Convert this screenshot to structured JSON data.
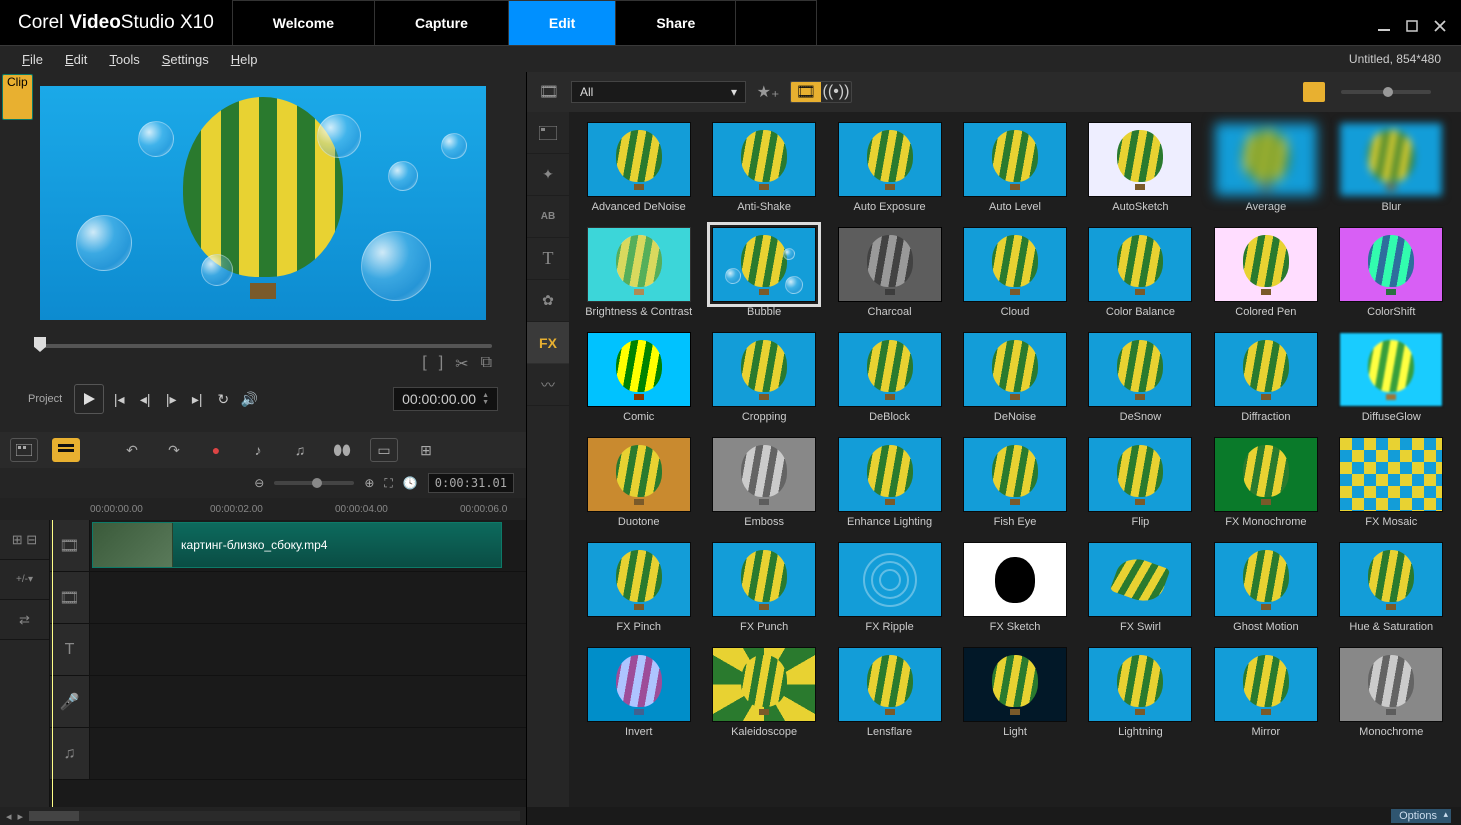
{
  "app": {
    "brand": "Corel",
    "product": "VideoStudio",
    "version": "X10"
  },
  "nav_tabs": {
    "welcome": "Welcome",
    "capture": "Capture",
    "edit": "Edit",
    "share": "Share",
    "active": "edit"
  },
  "project_info": "Untitled, 854*480",
  "menus": {
    "file": "File",
    "edit": "Edit",
    "tools": "Tools",
    "settings": "Settings",
    "help": "Help"
  },
  "playback": {
    "project_label": "Project",
    "clip_label": "Clip",
    "timecode": "00:00:00.00"
  },
  "timeline": {
    "duration": "0:00:31.01",
    "ruler": {
      "t0": "00:00:00.00",
      "t1": "00:00:02.00",
      "t2": "00:00:04.00",
      "t3": "00:00:06.0"
    },
    "clip_name": "картинг-близко_сбоку.mp4",
    "add_menu": "+/-▾"
  },
  "library": {
    "filter_label": "All",
    "side": {
      "fx": "FX"
    },
    "effects": [
      "Advanced DeNoise",
      "Anti-Shake",
      "Auto Exposure",
      "Auto Level",
      "AutoSketch",
      "Average",
      "Blur",
      "Brightness & Contrast",
      "Bubble",
      "Charcoal",
      "Cloud",
      "Color Balance",
      "Colored Pen",
      "ColorShift",
      "Comic",
      "Cropping",
      "DeBlock",
      "DeNoise",
      "DeSnow",
      "Diffraction",
      "DiffuseGlow",
      "Duotone",
      "Emboss",
      "Enhance Lighting",
      "Fish Eye",
      "Flip",
      "FX Monochrome",
      "FX Mosaic",
      "FX Pinch",
      "FX Punch",
      "FX Ripple",
      "FX Sketch",
      "FX Swirl",
      "Ghost Motion",
      "Hue & Saturation",
      "Invert",
      "Kaleidoscope",
      "Lensflare",
      "Light",
      "Lightning",
      "Mirror",
      "Monochrome"
    ],
    "selected": "Bubble"
  },
  "footer": {
    "options": "Options"
  }
}
